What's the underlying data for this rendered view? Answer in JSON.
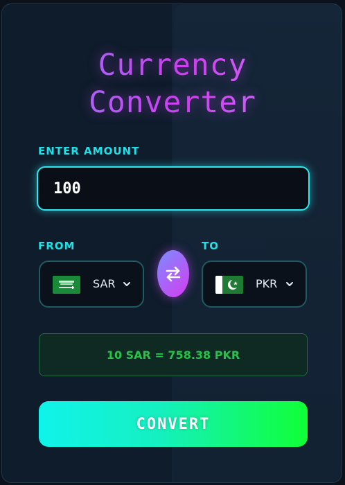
{
  "header": {
    "title_line1": "Currency",
    "title_line2": "Converter"
  },
  "amount": {
    "label": "ENTER AMOUNT",
    "value": "100"
  },
  "from": {
    "label": "FROM",
    "currency_code": "SAR",
    "flag_icon": "saudi-arabia-flag-icon"
  },
  "to": {
    "label": "TO",
    "currency_code": "PKR",
    "flag_icon": "pakistan-flag-icon"
  },
  "swap": {
    "icon": "swap-arrows-icon"
  },
  "result": {
    "text": "10 SAR = 758.38 PKR"
  },
  "convert_button": {
    "label": "CONVERT"
  },
  "colors": {
    "accent_cyan": "#18e3ea",
    "title_gradient_start": "#8f7dff",
    "title_gradient_mid": "#d23cf0",
    "result_text": "#27c24a",
    "button_gradient_start": "#10f3ea",
    "button_gradient_end": "#10ff36"
  }
}
